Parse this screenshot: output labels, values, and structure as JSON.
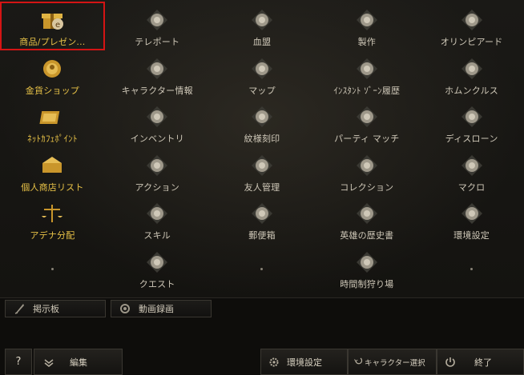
{
  "menu_items": [
    {
      "label": "商品/プレゼン...",
      "icon": "gift-box-icon",
      "gold": true,
      "selected": true
    },
    {
      "label": "テレポート",
      "icon": "teleport-swirl-icon",
      "gold": false
    },
    {
      "label": "血盟",
      "icon": "clan-banner-icon",
      "gold": false
    },
    {
      "label": "製作",
      "icon": "crafting-hammers-icon",
      "gold": false
    },
    {
      "label": "オリンピアード",
      "icon": "olympiad-emblem-icon",
      "gold": false
    },
    {
      "label": "金貨ショップ",
      "icon": "gold-coin-shop-icon",
      "gold": true
    },
    {
      "label": "キャラクター情報",
      "icon": "character-info-icon",
      "gold": false
    },
    {
      "label": "マップ",
      "icon": "map-icon",
      "gold": false
    },
    {
      "label": "ｲﾝｽﾀﾝﾄ ｿﾞｰﾝ履歴",
      "icon": "instant-zone-swords-icon",
      "gold": false
    },
    {
      "label": "ホムンクルス",
      "icon": "homunculus-heart-icon",
      "gold": false
    },
    {
      "label": "ﾈｯﾄｶﾌｪﾎﾟｲﾝﾄ",
      "icon": "netcafe-point-icon",
      "gold": true
    },
    {
      "label": "インベントリ",
      "icon": "inventory-bag-icon",
      "gold": false
    },
    {
      "label": "紋様刻印",
      "icon": "pattern-engrave-icon",
      "gold": false
    },
    {
      "label": "パーティ マッチ",
      "icon": "party-match-icon",
      "gold": false
    },
    {
      "label": "ディスローン",
      "icon": "dethrone-icon",
      "gold": false
    },
    {
      "label": "個人商店リスト",
      "icon": "private-store-icon",
      "gold": true
    },
    {
      "label": "アクション",
      "icon": "action-hand-icon",
      "gold": false
    },
    {
      "label": "友人管理",
      "icon": "friends-icon",
      "gold": false
    },
    {
      "label": "コレクション",
      "icon": "collection-icon",
      "gold": false
    },
    {
      "label": "マクロ",
      "icon": "macro-gear-icon",
      "gold": false
    },
    {
      "label": "アデナ分配",
      "icon": "adena-scale-icon",
      "gold": true
    },
    {
      "label": "スキル",
      "icon": "skill-book-icon",
      "gold": false
    },
    {
      "label": "郵便箱",
      "icon": "mailbox-icon",
      "gold": false
    },
    {
      "label": "英雄の歴史書",
      "icon": "hero-history-icon",
      "gold": false
    },
    {
      "label": "環境設定",
      "icon": "settings-icon",
      "gold": false
    },
    {
      "label": "",
      "icon": "",
      "dot": true
    },
    {
      "label": "クエスト",
      "icon": "quest-icon",
      "gold": false
    },
    {
      "label": "",
      "icon": "",
      "dot": true
    },
    {
      "label": "時間制狩り場",
      "icon": "timed-hunting-icon",
      "gold": false
    },
    {
      "label": "",
      "icon": "",
      "dot": true
    }
  ],
  "sub_buttons": {
    "board": "掲示板",
    "video": "動画録画"
  },
  "bottom_bar": {
    "help": "?",
    "edit": "編集",
    "settings": "環境設定",
    "char_select": "キャラクター選択",
    "exit": "終了"
  },
  "colors": {
    "gold": "#e8c247",
    "text": "#cfc8b8",
    "selected_border": "#d41414"
  }
}
